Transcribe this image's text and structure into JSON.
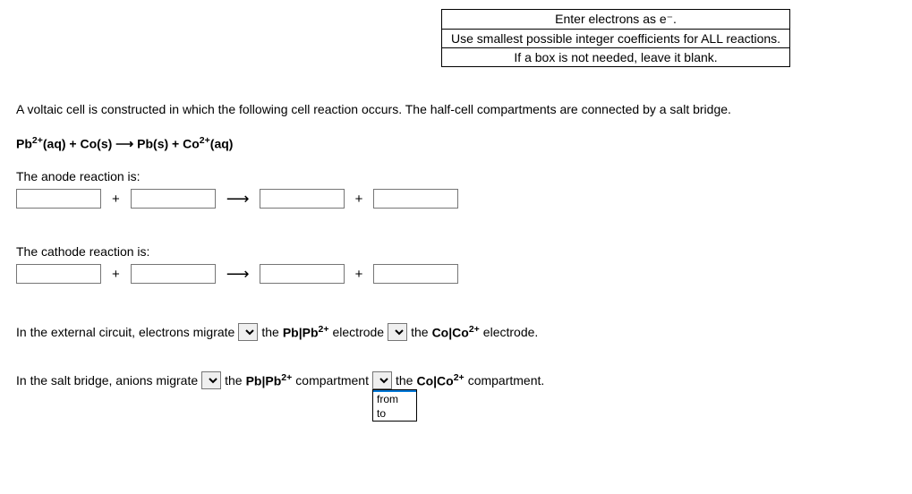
{
  "instructions": {
    "line1": "Enter electrons as e⁻.",
    "line2": "Use smallest possible integer coefficients for ALL reactions.",
    "line3": "If a box is not needed, leave it blank."
  },
  "intro": "A voltaic cell is constructed in which the following cell reaction occurs. The half-cell compartments are connected by a salt bridge.",
  "equation": {
    "r1": "Pb",
    "r1_sup": "2+",
    "r1_state": "(aq)",
    "plus1": " + ",
    "r2": "Co(s)",
    "arrow": " ⟶ ",
    "p1": "Pb(s)",
    "plus2": " + ",
    "p2": "Co",
    "p2_sup": "2+",
    "p2_state": "(aq)"
  },
  "anode_label": "The anode reaction is:",
  "cathode_label": "The cathode reaction is:",
  "symbols": {
    "plus": "+",
    "arrow": "⟶"
  },
  "sentence1": {
    "pre": "In the external circuit, electrons migrate ",
    "mid1_a": " the ",
    "mid1_b_pre": "Pb|Pb",
    "mid1_b_sup": "2+",
    "mid1_c": " electrode ",
    "mid2_a": " the ",
    "mid2_b_pre": "Co|Co",
    "mid2_b_sup": "2+",
    "mid2_c": " electrode."
  },
  "sentence2": {
    "pre": "In the salt bridge, anions migrate ",
    "mid1_a": " the ",
    "mid1_b_pre": "Pb|Pb",
    "mid1_b_sup": "2+",
    "mid1_c": " compartment ",
    "mid2_a": " the ",
    "mid2_b_pre": "Co|Co",
    "mid2_b_sup": "2+",
    "mid2_c": " compartment."
  },
  "dropdown": {
    "blank": "",
    "opt1": "from",
    "opt2": "to"
  }
}
